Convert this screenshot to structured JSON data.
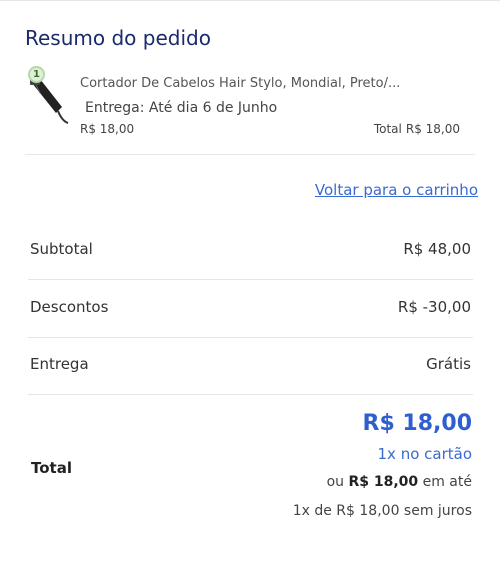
{
  "summary": {
    "title": "Resumo do pedido"
  },
  "item": {
    "quantity": "1",
    "name": "Cortador De Cabelos Hair Stylo, Mondial, Preto/...",
    "delivery": "Entrega: Até dia 6 de Junho",
    "unit_price": "R$ 18,00",
    "total_label": "Total",
    "total_value": "R$ 18,00",
    "image_icon": "hair-clipper-icon"
  },
  "back_link": "Voltar para o carrinho",
  "rows": [
    {
      "label": "Subtotal",
      "value": "R$ 48,00"
    },
    {
      "label": "Descontos",
      "value": "R$ -30,00"
    },
    {
      "label": "Entrega",
      "value": "Grátis"
    }
  ],
  "total": {
    "label": "Total",
    "amount": "R$ 18,00",
    "card": "1x no cartão",
    "or_prefix": "ou",
    "or_amount": "R$ 18,00",
    "or_suffix": "em até",
    "installments": "1x de R$ 18,00 sem juros"
  },
  "colors": {
    "title": "#1a2a6c",
    "link": "#3a6bd1",
    "total": "#2f5fcf"
  }
}
